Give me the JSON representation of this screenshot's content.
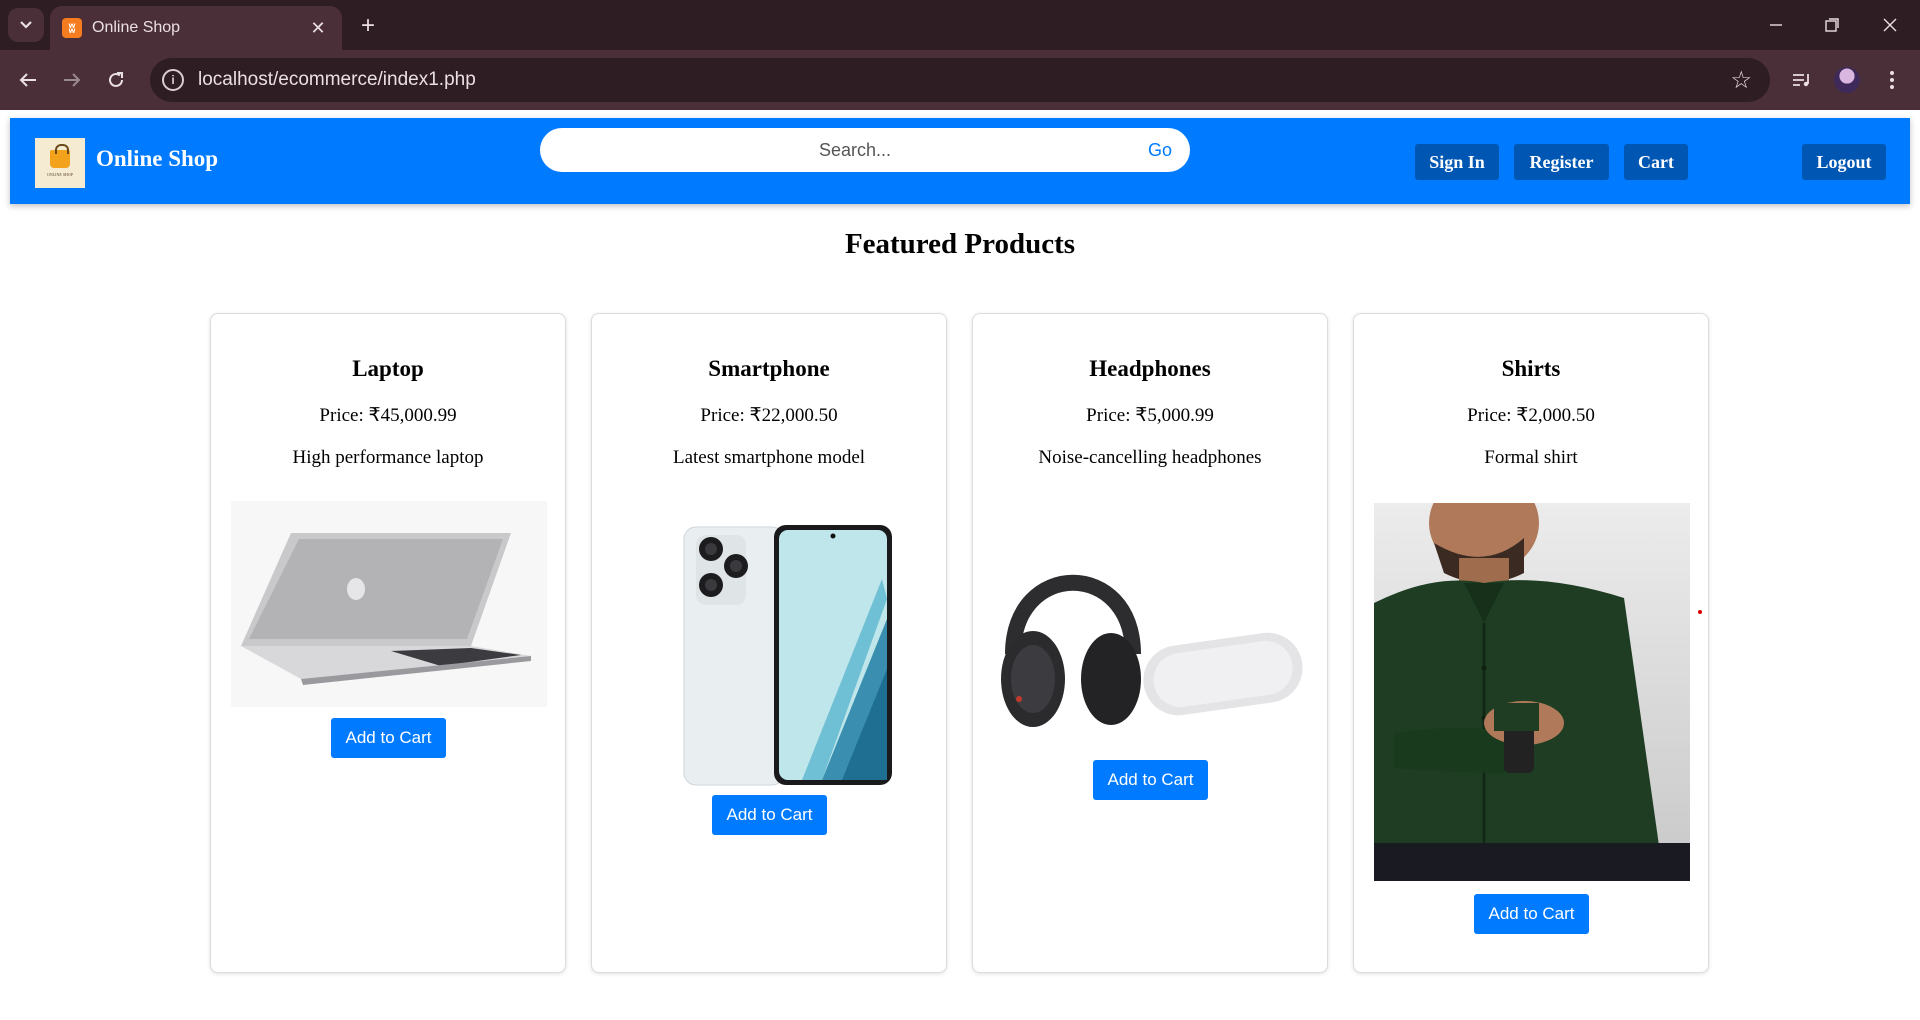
{
  "browser": {
    "tab_title": "Online Shop",
    "url": "localhost/ecommerce/index1.php"
  },
  "header": {
    "brand": "Online Shop",
    "search_placeholder": "Search...",
    "search_button": "Go",
    "nav": [
      "Sign In",
      "Register",
      "Cart",
      "Logout"
    ],
    "accent_color": "#007bff",
    "button_color": "#0056b3"
  },
  "main": {
    "title": "Featured Products",
    "add_label": "Add to Cart",
    "products": [
      {
        "name": "Laptop",
        "price": "Price: ₹45,000.99",
        "desc": "High performance laptop"
      },
      {
        "name": "Smartphone",
        "price": "Price: ₹22,000.50",
        "desc": "Latest smartphone model"
      },
      {
        "name": "Headphones",
        "price": "Price: ₹5,000.99",
        "desc": "Noise-cancelling headphones"
      },
      {
        "name": "Shirts",
        "price": "Price: ₹2,000.50",
        "desc": "Formal shirt"
      }
    ]
  }
}
